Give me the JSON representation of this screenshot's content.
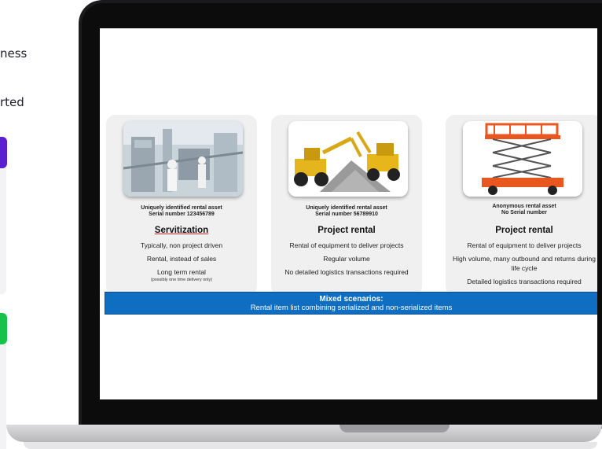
{
  "page_fragments": {
    "line1": "ness",
    "line2": "rted"
  },
  "cards": [
    {
      "subtitle_line1": "Uniquely identified rental asset",
      "subtitle_line2": "Serial number 123456789",
      "title": "Servitization",
      "lines": [
        "Typically, non project driven",
        "Rental, instead of sales",
        "Long term rental"
      ],
      "note": "(possibly one time delivery only)",
      "image": "industrial-plant-photo"
    },
    {
      "subtitle_line1": "Uniquely identified rental asset",
      "subtitle_line2": "Serial number 56789910",
      "title": "Project rental",
      "lines": [
        "Rental of equipment to deliver projects",
        "Regular volume",
        "No detailed logistics transactions required"
      ],
      "image": "excavators-photo"
    },
    {
      "subtitle_line1": "Anonymous rental asset",
      "subtitle_line2": "No Serial number",
      "title": "Project rental",
      "lines": [
        "Rental of equipment to deliver projects",
        "High volume, many outbound and returns during life cycle",
        "Detailed logistics transactions required"
      ],
      "image": "scissor-lift-photo"
    }
  ],
  "mixed_bar": {
    "title": "Mixed scenarios:",
    "text": "Rental item list combining serialized and non-serialized items"
  },
  "colors": {
    "bar": "#0f6ec2",
    "purple_accent": "#5b1fcf",
    "green_accent": "#16c24a"
  }
}
